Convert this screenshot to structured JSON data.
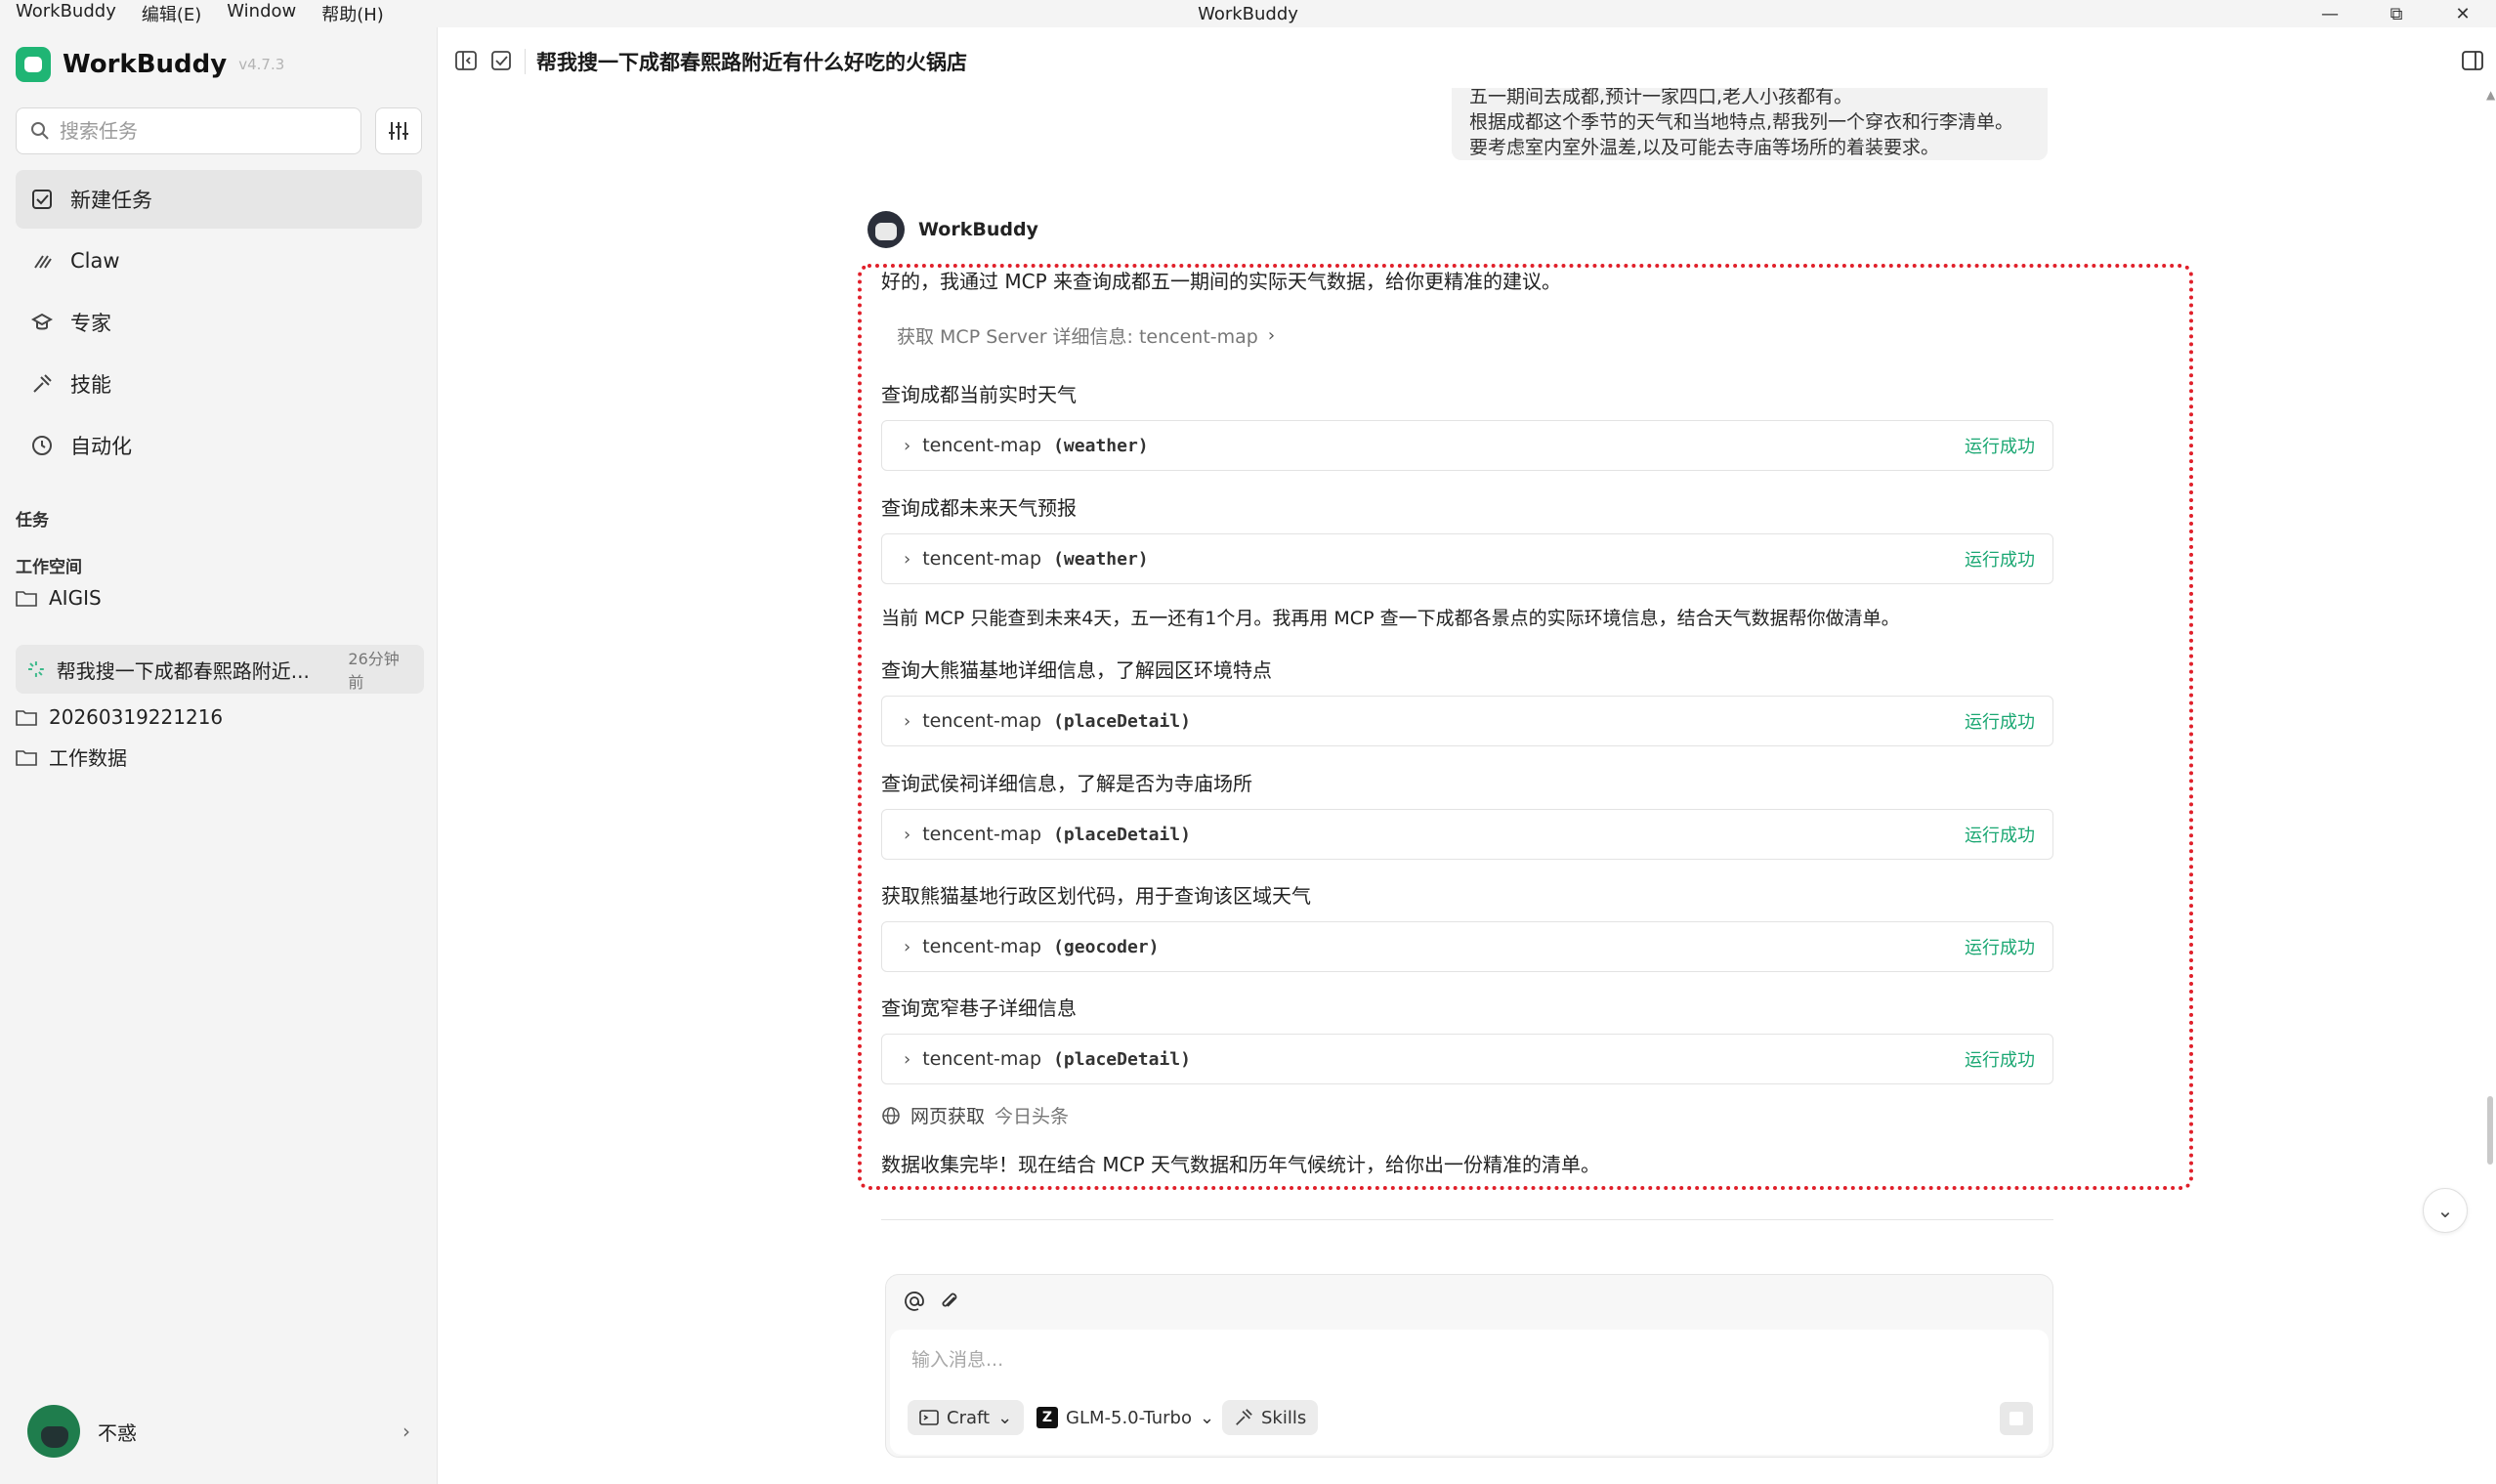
{
  "window": {
    "title": "WorkBuddy",
    "menu": [
      "WorkBuddy",
      "编辑(E)",
      "Window",
      "帮助(H)"
    ]
  },
  "sidebar": {
    "brand": "WorkBuddy",
    "version": "v4.7.3",
    "search_placeholder": "搜索任务",
    "nav": [
      {
        "label": "新建任务",
        "icon": "new-task-icon"
      },
      {
        "label": "Claw",
        "icon": "claw-icon"
      },
      {
        "label": "专家",
        "icon": "expert-icon"
      },
      {
        "label": "技能",
        "icon": "skill-icon"
      },
      {
        "label": "自动化",
        "icon": "clock-icon"
      }
    ],
    "tasks_label": "任务",
    "workspace_label": "工作空间",
    "workspaces": [
      "AIGIS",
      "20260319221216",
      "工作数据"
    ],
    "active_task": {
      "title": "帮我搜一下成都春熙路附近...",
      "time": "26分钟前"
    },
    "user_name": "不惑"
  },
  "header": {
    "title": "帮我搜一下成都春熙路附近有什么好吃的火锅店"
  },
  "conversation": {
    "user_bubble": {
      "line1": "五一期间去成都,预计一家四口,老人小孩都有。",
      "line2": "根据成都这个季节的天气和当地特点,帮我列一个穿衣和行李清单。",
      "line3": "要考虑室内室外温差,以及可能去寺庙等场所的着装要求。"
    },
    "bot_name": "WorkBuddy",
    "intro": "好的，我通过 MCP 来查询成都五一期间的实际天气数据，给你更精准的建议。",
    "mcp_info": "获取 MCP Server 详细信息: tencent-map",
    "steps": [
      {
        "text": "查询成都当前实时天气",
        "server": "tencent-map",
        "fn": "(weather)",
        "status": "运行成功"
      },
      {
        "text": "查询成都未来天气预报",
        "server": "tencent-map",
        "fn": "(weather)",
        "status": "运行成功"
      },
      {
        "text": "查询大熊猫基地详细信息，了解园区环境特点",
        "server": "tencent-map",
        "fn": "(placeDetail)",
        "status": "运行成功"
      },
      {
        "text": "查询武侯祠详细信息，了解是否为寺庙场所",
        "server": "tencent-map",
        "fn": "(placeDetail)",
        "status": "运行成功"
      },
      {
        "text": "获取熊猫基地行政区划代码，用于查询该区域天气",
        "server": "tencent-map",
        "fn": "(geocoder)",
        "status": "运行成功"
      },
      {
        "text": "查询宽窄巷子详细信息",
        "server": "tencent-map",
        "fn": "(placeDetail)",
        "status": "运行成功"
      }
    ],
    "mid_note": "当前 MCP 只能查到未来4天，五一还有1个月。我再用 MCP 查一下成都各景点的实际环境信息，结合天气数据帮你做清单。",
    "web_fetch": {
      "label": "网页获取",
      "source": "今日头条"
    },
    "conclusion": "数据收集完毕！现在结合 MCP 天气数据和历年气候统计，给你出一份精准的清单。"
  },
  "composer": {
    "placeholder": "输入消息...",
    "mode": "Craft",
    "model": "GLM-5.0-Turbo",
    "skills": "Skills"
  },
  "colors": {
    "accent_green": "#1aa772",
    "highlight_red": "#e0202a",
    "brand_green": "#1fb574"
  }
}
